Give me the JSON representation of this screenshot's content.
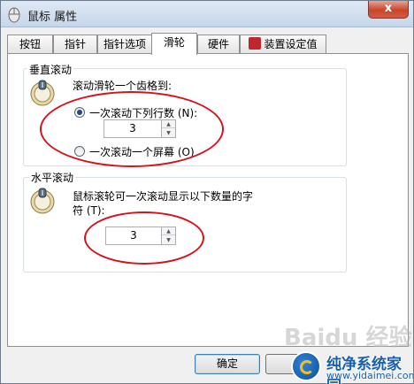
{
  "window": {
    "title": "鼠标 属性",
    "close_label": "x"
  },
  "tabs": [
    {
      "label": "按钮"
    },
    {
      "label": "指针"
    },
    {
      "label": "指针选项"
    },
    {
      "label": "滑轮"
    },
    {
      "label": "硬件"
    },
    {
      "label": "装置设定值"
    }
  ],
  "vertical": {
    "title": "垂直滚动",
    "instruction": "滚动滑轮一个齿格到:",
    "option_lines_label": "一次滚动下列行数 (N):",
    "lines_value": "3",
    "option_screen_label": "一次滚动一个屏幕 (O)"
  },
  "horizontal": {
    "title": "水平滚动",
    "instruction_line1": "鼠标滚轮可一次滚动显示以下数量的字",
    "instruction_line2": "符 (T):",
    "chars_value": "3"
  },
  "buttons": {
    "ok": "确定"
  },
  "watermark": {
    "baidu": "Baidu 经验",
    "site_name": "纯净系统家园",
    "site_url": "www.yidaimei.com"
  },
  "colors": {
    "annotation": "#d7121b",
    "titlebar": "#c6d6ea",
    "close": "#c9452d"
  }
}
